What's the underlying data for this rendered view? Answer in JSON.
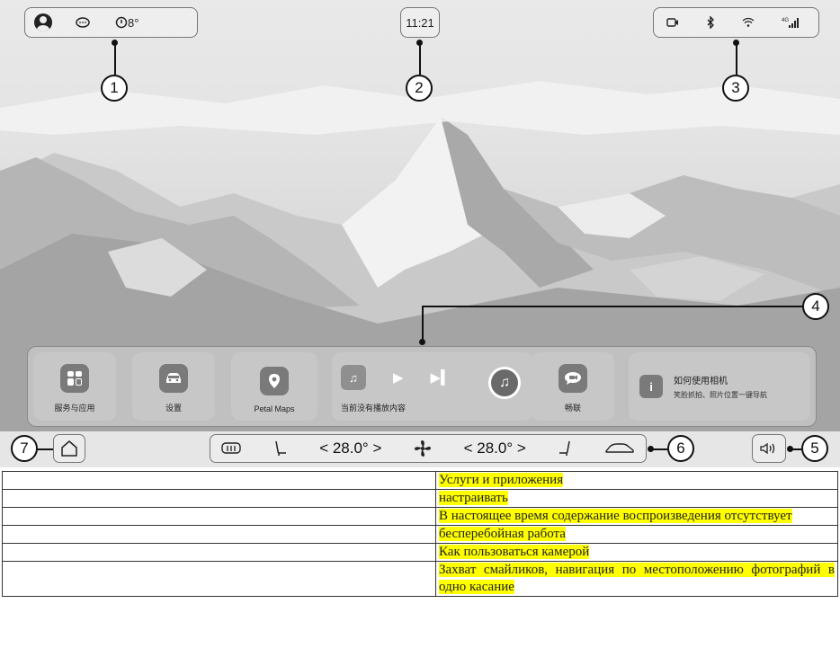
{
  "status_bar": {
    "weather": "8°",
    "time": "11:21",
    "network": "4G"
  },
  "callouts": [
    "1",
    "2",
    "3",
    "4",
    "5",
    "6",
    "7"
  ],
  "dock": {
    "apps": [
      {
        "label": "服务与应用",
        "icon": "apps-grid-icon"
      },
      {
        "label": "设置",
        "icon": "car-settings-icon"
      },
      {
        "label": "Petal Maps",
        "icon": "map-pin-icon"
      }
    ],
    "media": {
      "empty_text": "当前没有播放内容"
    },
    "changlian": {
      "label": "畅联",
      "icon": "chat-bubble-icon"
    },
    "tip": {
      "title": "如何使用相机",
      "subtitle": "笑脸抓拍、照片位置一键导航"
    }
  },
  "climate": {
    "left_temp": "28.0°",
    "right_temp": "28.0°"
  },
  "translation_table": {
    "rows": [
      "Услуги и приложения",
      "настраивать",
      "В настоящее время содержание воспроизведения отсутствует",
      "бесперебойная работа",
      "Как пользоваться камерой",
      "Захват смайликов, навигация по местоположению фотографий в одно касание"
    ]
  },
  "colors": {
    "highlight": "#ffff00",
    "icon_tile": "#7a7a7a"
  }
}
